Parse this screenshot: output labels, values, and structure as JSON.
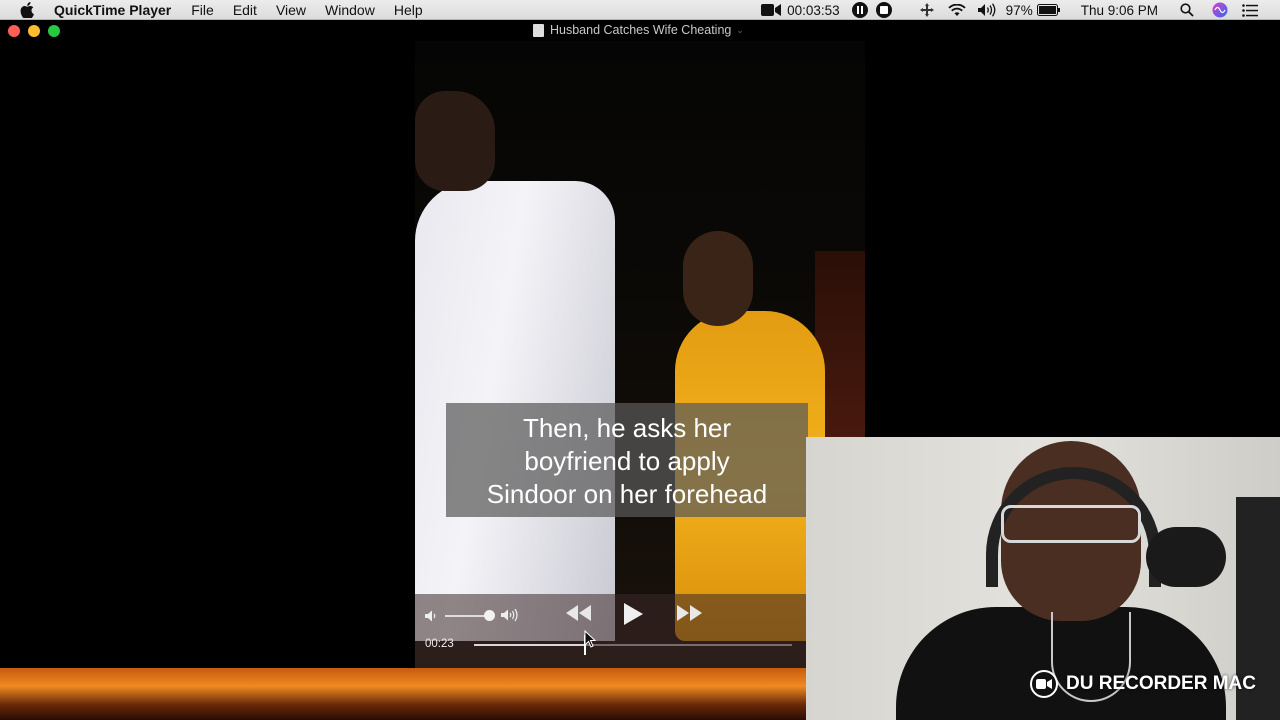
{
  "menubar": {
    "app_name": "QuickTime Player",
    "menus": [
      "File",
      "Edit",
      "View",
      "Window",
      "Help"
    ],
    "recording_time": "00:03:53",
    "battery": "97%",
    "clock": "Thu 9:06 PM"
  },
  "window": {
    "title": "Husband Catches Wife Cheating"
  },
  "video": {
    "caption_lines": [
      "Then, he asks her",
      "boyfriend to apply",
      "Sindoor on her forehead"
    ]
  },
  "player": {
    "current_time": "00:23",
    "progress": 0.35
  },
  "overlay": {
    "watermark": "DU RECORDER MAC"
  },
  "colors": {
    "saree": "#f3b21c",
    "sunset": "#f08a20"
  }
}
